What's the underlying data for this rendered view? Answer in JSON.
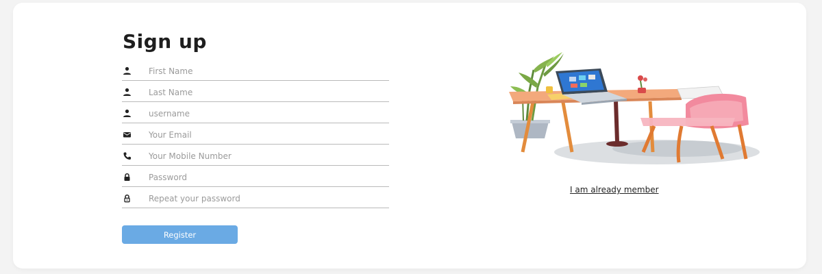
{
  "form": {
    "title": "Sign up",
    "fields": [
      {
        "placeholder": "First Name",
        "value": "",
        "icon": "person-icon"
      },
      {
        "placeholder": "Last Name",
        "value": "",
        "icon": "person-icon"
      },
      {
        "placeholder": "username",
        "value": "",
        "icon": "person-icon"
      },
      {
        "placeholder": "Your Email",
        "value": "",
        "icon": "email-icon"
      },
      {
        "placeholder": "Your Mobile Number",
        "value": "",
        "icon": "phone-icon"
      },
      {
        "placeholder": "Password",
        "value": "",
        "icon": "lock-icon"
      },
      {
        "placeholder": "Repeat your password",
        "value": "",
        "icon": "lock-outline-icon"
      }
    ],
    "register_label": "Register"
  },
  "side": {
    "illustration_icon": "desk-laptop-illustration",
    "member_link": "I am already member"
  },
  "colors": {
    "accent": "#6aaae4",
    "background": "#f3f3f3",
    "card": "#ffffff",
    "title": "#1e1e1e"
  }
}
